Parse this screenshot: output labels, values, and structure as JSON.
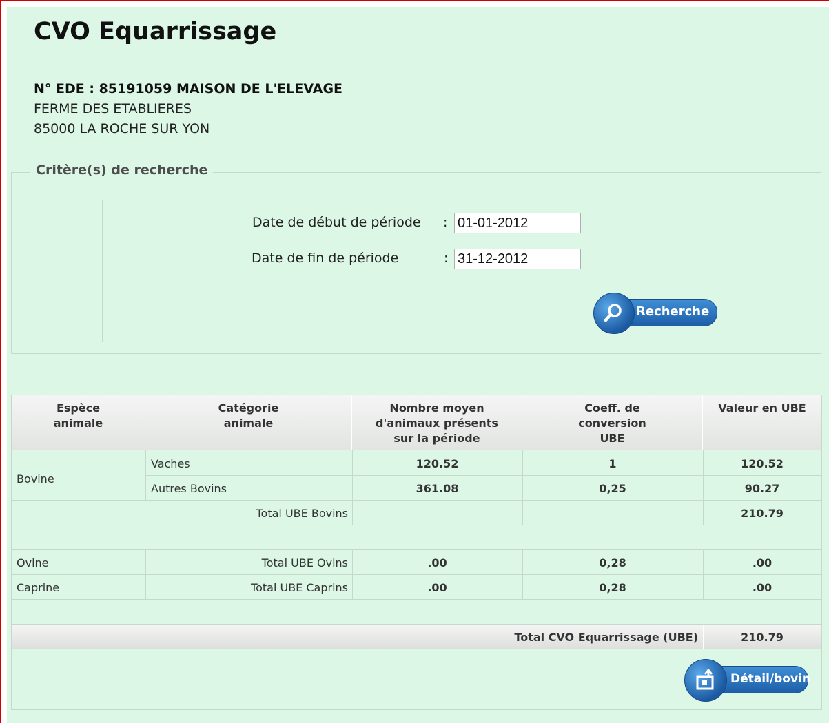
{
  "page": {
    "title": "CVO Equarrissage",
    "ede_line": "N° EDE : 85191059 MAISON DE L'ELEVAGE",
    "address_line1": "FERME DES ETABLIERES",
    "address_line2": "85000 LA ROCHE SUR YON"
  },
  "criteria": {
    "legend": "Critère(s) de recherche",
    "start_label": "Date de début de période",
    "start_colon": ":",
    "start_value": "01-01-2012",
    "end_label": "Date de fin de période",
    "end_colon": ":",
    "end_value": "31-12-2012",
    "search_button": "Recherche"
  },
  "table": {
    "headers": {
      "espece_line1": "Espèce",
      "espece_line2": "animale",
      "categorie_line1": "Catégorie",
      "categorie_line2": "animale",
      "nombre_line1": "Nombre moyen",
      "nombre_line2": "d'animaux présents",
      "nombre_line3": "sur la période",
      "coeff_line1": "Coeff. de",
      "coeff_line2": "conversion",
      "coeff_line3": "UBE",
      "valeur": "Valeur en UBE"
    },
    "bovine": {
      "espece": "Bovine",
      "rows": [
        {
          "categorie": "Vaches",
          "nombre": "120.52",
          "coeff": "1",
          "valeur": "120.52"
        },
        {
          "categorie": "Autres Bovins",
          "nombre": "361.08",
          "coeff": "0,25",
          "valeur": "90.27"
        }
      ],
      "total_label": "Total UBE Bovins",
      "total_value": "210.79"
    },
    "ovine": {
      "espece": "Ovine",
      "label": "Total UBE Ovins",
      "nombre": ".00",
      "coeff": "0,28",
      "valeur": ".00"
    },
    "caprine": {
      "espece": "Caprine",
      "label": "Total UBE Caprins",
      "nombre": ".00",
      "coeff": "0,28",
      "valeur": ".00"
    },
    "grand_total_label": "Total CVO Equarrissage (UBE)",
    "grand_total_value": "210.79"
  },
  "detail_button": "Détail/bovin",
  "colors": {
    "panel": "#dcf7e6",
    "accent": "#1d5fa8",
    "frame": "#d40000"
  },
  "icons": {
    "search": "magnifier-icon",
    "detail": "document-export-icon"
  }
}
